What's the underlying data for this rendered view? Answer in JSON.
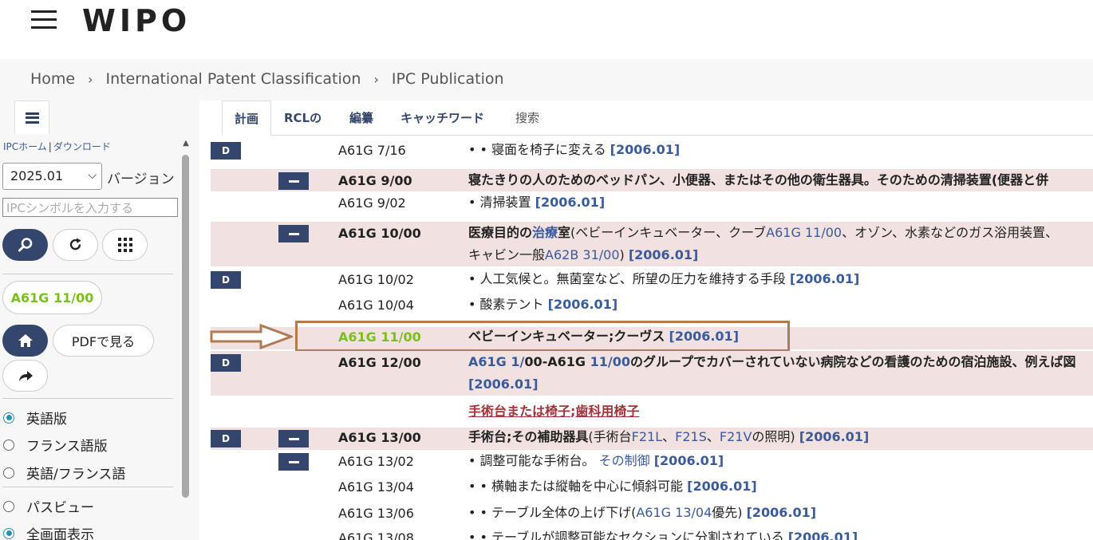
{
  "header": {
    "logo": "WIPO"
  },
  "breadcrumb": [
    "Home",
    "International Patent Classification",
    "IPC Publication"
  ],
  "sidebar": {
    "links": {
      "home": "IPCホーム",
      "download": "ダウンロード"
    },
    "version_value": "2025.01",
    "version_label": "バージョン",
    "symbol_placeholder": "IPCシンボルを入力する",
    "current_symbol": "A61G 11/00",
    "pdf_label": "PDFで見る",
    "lang_options": [
      {
        "label": "英語版",
        "checked": true
      },
      {
        "label": "フランス語版",
        "checked": false
      },
      {
        "label": "英語/フランス語",
        "checked": false
      }
    ],
    "view_options": [
      {
        "label": "パスビュー",
        "checked": false
      },
      {
        "label": "全画面表示",
        "checked": true
      }
    ]
  },
  "tabs": [
    "計画",
    "RCLの",
    "編纂",
    "キャッチワード",
    "搜索"
  ],
  "rows": [
    {
      "code": "A61G 7/16",
      "desc": "• • 寝面を椅子に変える",
      "ver": "[2006.01]"
    },
    {
      "code": "A61G 9/00",
      "desc": "寝たきりの人のためのベッドパン、小便器、またはその他の衛生器具。そのための清掃装置(便器と併",
      "ver": ""
    },
    {
      "code": "A61G 9/02",
      "desc": "• 清掃装置",
      "ver": "[2006.01]"
    },
    {
      "code": "A61G 10/00",
      "desc_a": "医療目的の",
      "desc_link": "治療",
      "desc_b": "室",
      "desc_c": "(ベビーインキュベーター、クーブ",
      "ref1": "A61G 11/00",
      "desc_d": "、オゾン、水素などのガス浴用装置、",
      "line2_a": "キャビン一般",
      "ref2": "A62B 31/00",
      "line2_b": ")",
      "ver": "[2006.01]"
    },
    {
      "code": "A61G 10/02",
      "desc": "• 人工気候と。無菌室など、所望の圧力を維持する手段",
      "ver": "[2006.01]"
    },
    {
      "code": "A61G 10/04",
      "desc": "• 酸素テント",
      "ver": "[2006.01]"
    },
    {
      "code": "A61G 11/00",
      "desc": "ベビーインキュベーター;クーヴス",
      "ver": "[2006.01]"
    },
    {
      "code": "A61G 12/00",
      "ref1": "A61G 1/",
      "mid1": "00-A61G ",
      "ref2": "11/00",
      "desc": "のグループでカバーされていない病院などの看護のための宿泊施設、例えば図",
      "ver": "[2006.01]"
    },
    {
      "link": "手術台または椅子",
      "sep": ";",
      "link2": "歯科用椅子"
    },
    {
      "code": "A61G 13/00",
      "desc_a": "手術台;その補助器具",
      "desc_b": "(手術台",
      "ref1": "F21L",
      "s1": "、",
      "ref2": "F21S",
      "s2": "、",
      "ref3": "F21V",
      "desc_c": "の照明)",
      "ver": "[2006.01]"
    },
    {
      "code": "A61G 13/02",
      "desc": "• 調整可能な手術台。",
      "link": "その制御",
      "ver": "[2006.01]"
    },
    {
      "code": "A61G 13/04",
      "desc": "• • 横軸または縦軸を中心に傾斜可能",
      "ver": "[2006.01]"
    },
    {
      "code": "A61G 13/06",
      "desc": "• • テーブル全体の上げ下げ(",
      "ref": "A61G 13/04",
      "desc_b": "優先)",
      "ver": "[2006.01]"
    },
    {
      "code": "A61G 13/08",
      "desc": "• • テーブルが調整可能なセクションに分割されている",
      "ver": "[2006.01]"
    }
  ],
  "badges": {
    "d": "D"
  }
}
